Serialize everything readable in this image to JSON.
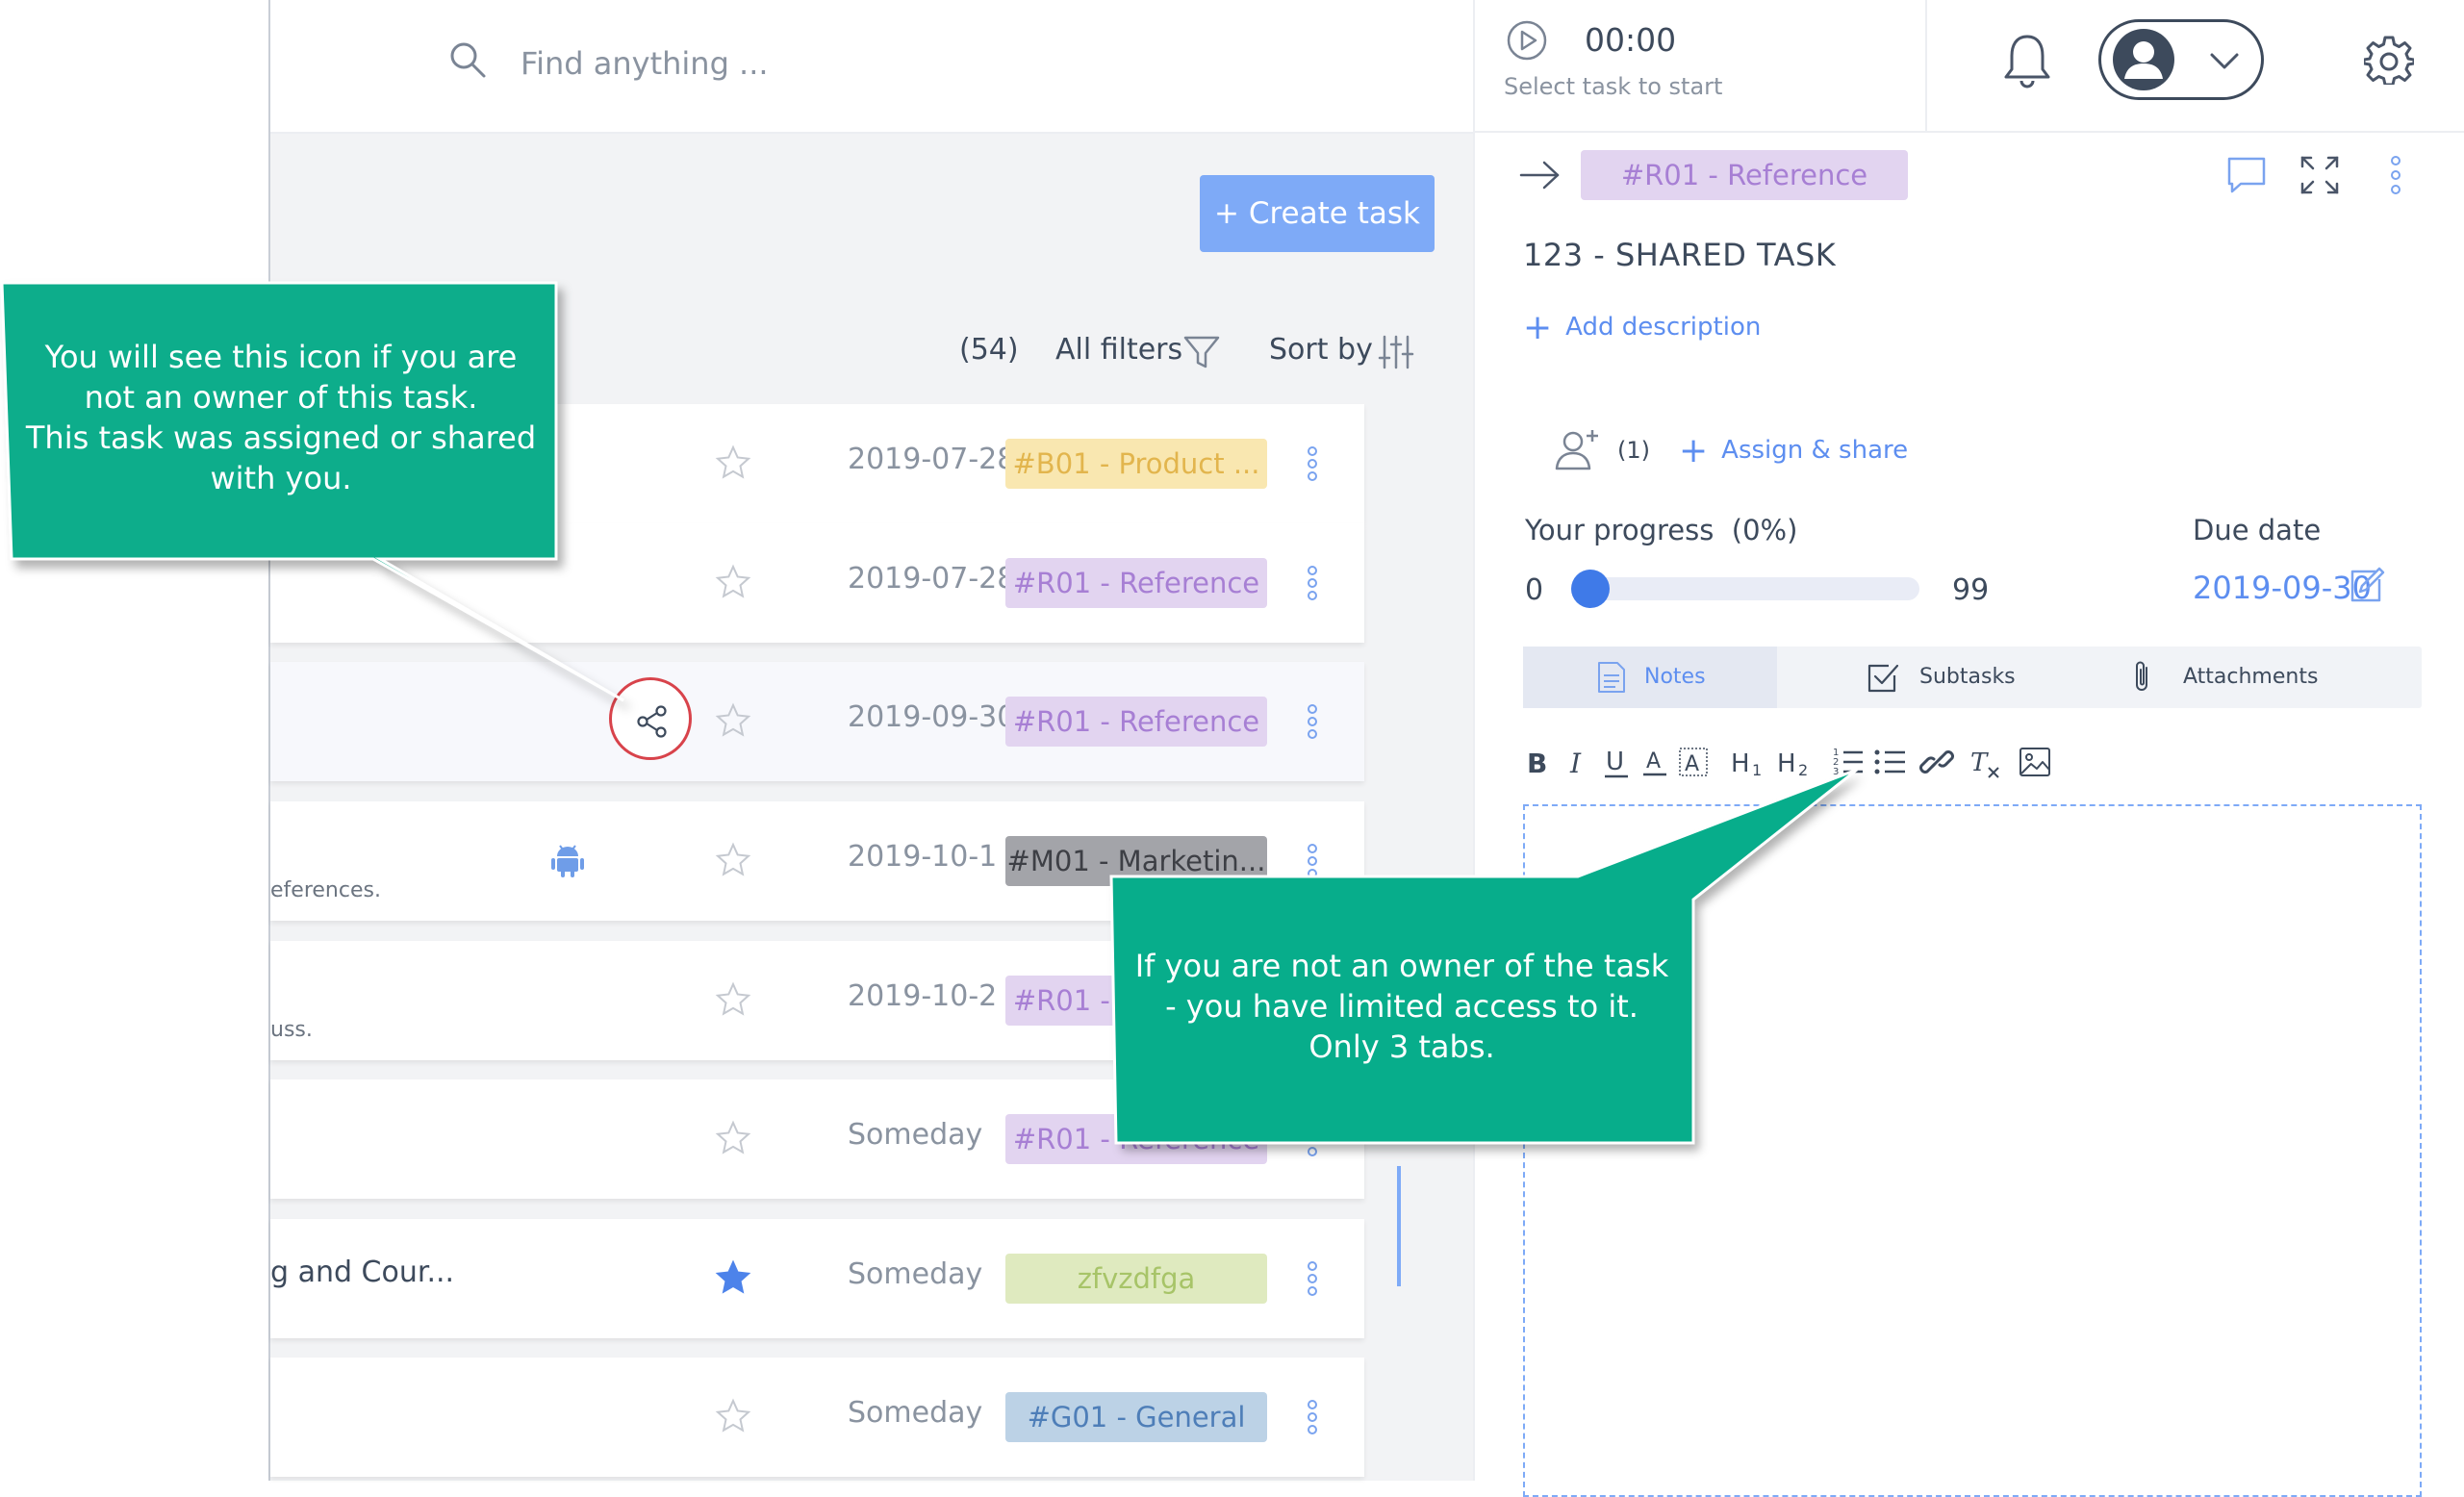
{
  "search": {
    "placeholder": "Find anything ..."
  },
  "toolbar": {
    "create_task_label": "+ Create task",
    "count": "(54)",
    "all_filters_label": "All filters",
    "sort_by_label": "Sort by"
  },
  "tasks": [
    {
      "title": "",
      "subtitle": "",
      "date": "2019-07-28",
      "tag": "#B01 - Product ...",
      "tag_bg": "#f9e7b0",
      "tag_color": "#e2b54d",
      "starred": false
    },
    {
      "title": "",
      "subtitle": "",
      "date": "2019-07-28",
      "tag": "#R01 - Reference",
      "tag_bg": "#e2d4f0",
      "tag_color": "#a77fd4",
      "starred": false
    },
    {
      "title": "",
      "subtitle": "",
      "date": "2019-09-30",
      "tag": "#R01 - Reference",
      "tag_bg": "#e2d4f0",
      "tag_color": "#a77fd4",
      "starred": false,
      "shared": true
    },
    {
      "title": "",
      "subtitle": "eferences.",
      "date": "2019-10-1",
      "tag": "#M01 - Marketin...",
      "tag_bg": "#a3a4a9",
      "tag_color": "#3d3f45",
      "starred": false,
      "android": true
    },
    {
      "title": "",
      "subtitle": "uss.",
      "date": "2019-10-2",
      "tag": "#R01 - Reference",
      "tag_bg": "#e2d4f0",
      "tag_color": "#a77fd4",
      "starred": false
    },
    {
      "title": "",
      "subtitle": "",
      "date": "Someday",
      "tag": "#R01 - Reference",
      "tag_bg": "#e2d4f0",
      "tag_color": "#a77fd4",
      "starred": false
    },
    {
      "title": "g and Cour...",
      "subtitle": "",
      "date": "Someday",
      "tag": "zfvzdfga",
      "tag_bg": "#dfeabf",
      "tag_color": "#a7c468",
      "starred": true
    },
    {
      "title": "",
      "subtitle": "",
      "date": "Someday",
      "tag": "#G01 - General",
      "tag_bg": "#bcd2e6",
      "tag_color": "#4e7eb8",
      "starred": false
    }
  ],
  "timer": {
    "time": "00:00",
    "hint": "Select task to start"
  },
  "detail": {
    "tag": "#R01 - Reference",
    "title": "123 - SHARED TASK",
    "add_description": "Add description",
    "assign_count": "(1)",
    "assign_share": "Assign & share",
    "progress_label": "Your progress  (0%)",
    "progress_min": "0",
    "progress_max": "99",
    "progress_value": 0,
    "due_label": "Due date",
    "due_date": "2019-09-30",
    "tabs": [
      {
        "label": "Notes",
        "active": true
      },
      {
        "label": "Subtasks",
        "active": false
      },
      {
        "label": "Attachments",
        "active": false
      }
    ]
  },
  "callouts": {
    "top_left": "You will see this icon if you are not an owner of this task.\nThis task was assigned or shared with you.",
    "bottom": "If you are not an owner of the task - you have limited access to it.\nOnly 3 tabs."
  },
  "colors": {
    "accent": "#5d8ef0",
    "button": "#7eaaf7",
    "callout": "#07ad8b",
    "highlight_ring": "#d8434b"
  }
}
